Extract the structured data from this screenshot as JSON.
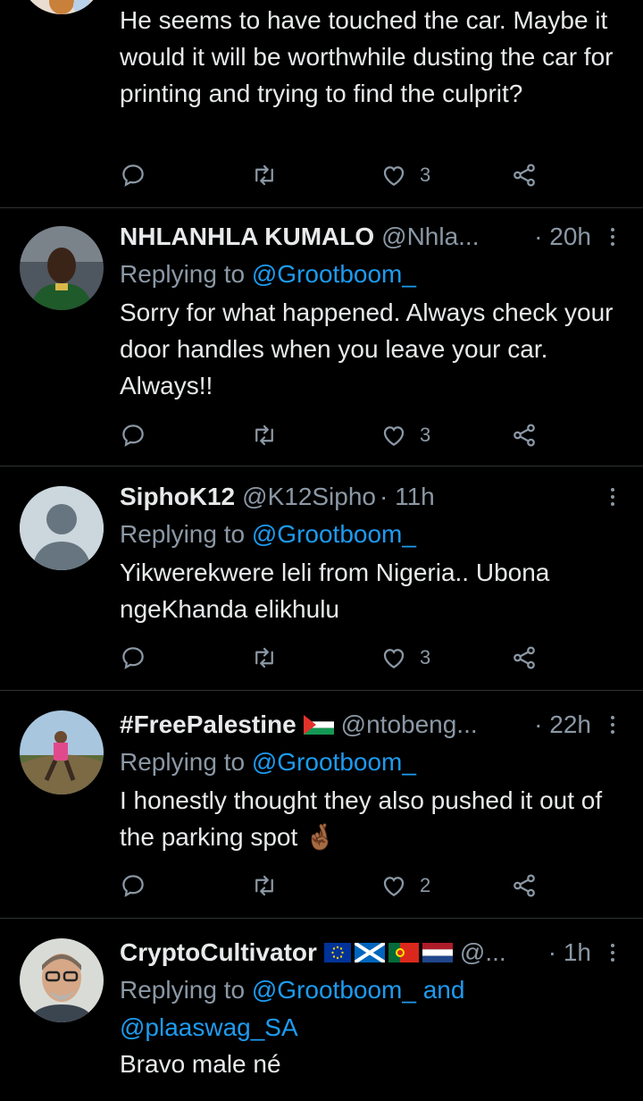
{
  "tweets": [
    {
      "body": "He seems to have touched the car. Maybe it would it will be worthwhile dusting the car for printing and trying to find the culprit?",
      "likes": "3"
    },
    {
      "name": "NHLANHLA KUMALO",
      "handle": "@Nhla...",
      "time": "· 20h",
      "replying_prefix": "Replying to",
      "replying_to": "@Grootboom_",
      "body": "Sorry for what happened. Always check your door handles when you leave your car. Always!!",
      "likes": "3"
    },
    {
      "name": "SiphoK12",
      "handle": "@K12Sipho",
      "time": "· 11h",
      "replying_prefix": "Replying to",
      "replying_to": "@Grootboom_",
      "body": "Yikwerekwere leli from Nigeria.. Ubona ngeKhanda elikhulu",
      "likes": "3"
    },
    {
      "name": "#FreePalestine",
      "handle": "@ntobeng...",
      "time": "· 22h",
      "replying_prefix": "Replying to",
      "replying_to": "@Grootboom_",
      "body": "I honestly thought they also pushed it out of the parking spot 🤞🏾",
      "likes": "2"
    },
    {
      "name": "CryptoCultivator",
      "handle": "@...",
      "time": "· 1h",
      "replying_prefix": "Replying to",
      "replying_to": "@Grootboom_ and",
      "replying_to_2": "@plaaswag_SA",
      "body": "Bravo male né"
    }
  ],
  "colors": {
    "background": "#000000",
    "text": "#e7e9ea",
    "secondary": "#8b98a5",
    "link": "#1d9bf0",
    "divider": "#2f3336"
  },
  "icons": [
    "reply-icon",
    "retweet-icon",
    "like-icon",
    "share-icon",
    "more-icon"
  ]
}
